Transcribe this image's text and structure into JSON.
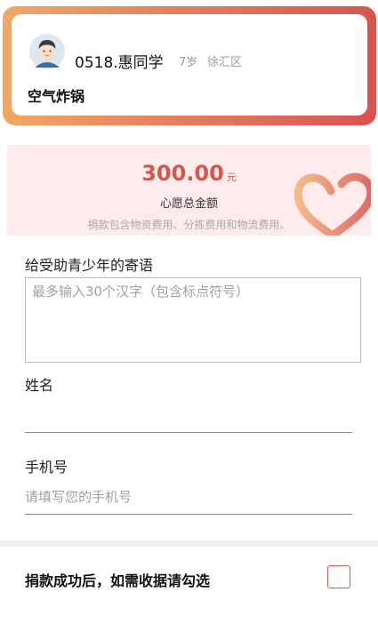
{
  "child": {
    "name": "0518.惠同学",
    "age": "7岁",
    "district": "徐汇区",
    "wish": "空气炸锅"
  },
  "total": {
    "amount": "300.00",
    "unit": "元",
    "label": "心愿总金额",
    "note": "捐款包含物资费用、分拣费用和物流费用。"
  },
  "form": {
    "message_label": "给受助青少年的寄语",
    "message_placeholder": "最多输入30个汉字（包含标点符号）",
    "name_label": "姓名",
    "name_value": "",
    "phone_label": "手机号",
    "phone_placeholder": "请填写您的手机号"
  },
  "receipt": {
    "label": "捐款成功后，如需收据请勾选"
  },
  "colors": {
    "accent": "#d9534f",
    "gradient_start": "#f0a866",
    "total_bg": "#fdeceb"
  }
}
